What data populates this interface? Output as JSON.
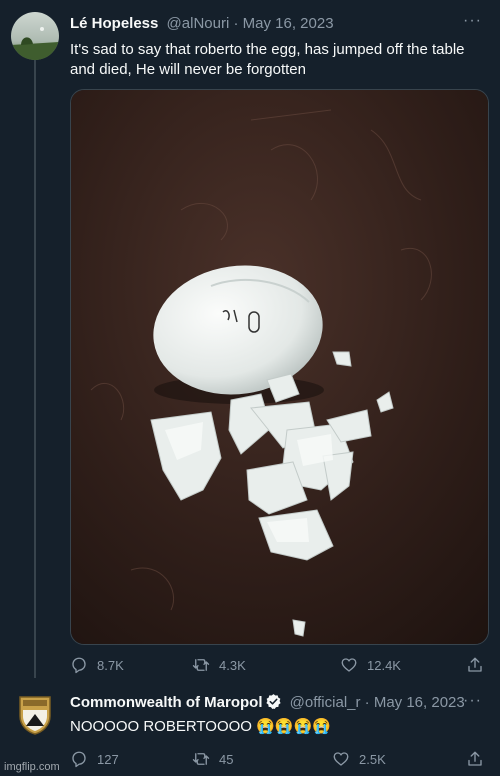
{
  "tweet1": {
    "name": "Lé Hopeless",
    "handle": "@alNouri",
    "sep": " · ",
    "date": "May 16, 2023",
    "more": "···",
    "text": "It's sad to say that roberto the egg, has jumped off the table and died, He will never be forgotten",
    "stats": {
      "replies": "8.7K",
      "retweets": "4.3K",
      "likes": "12.4K"
    }
  },
  "tweet2": {
    "name": "Commonwealth of Maropol",
    "handle": "@official_r",
    "sep": " · ",
    "date": "May 16, 2023",
    "more": "···",
    "text": "NOOOOO ROBERTOOOO 😭😭😭😭",
    "stats": {
      "replies": "127",
      "retweets": "45",
      "likes": "2.5K"
    }
  },
  "watermark": "imgflip.com",
  "colors": {
    "background": "#15202b",
    "secondary_text": "#8b98a5",
    "verified": "#1d9bf0",
    "table": "#2b1c18"
  }
}
